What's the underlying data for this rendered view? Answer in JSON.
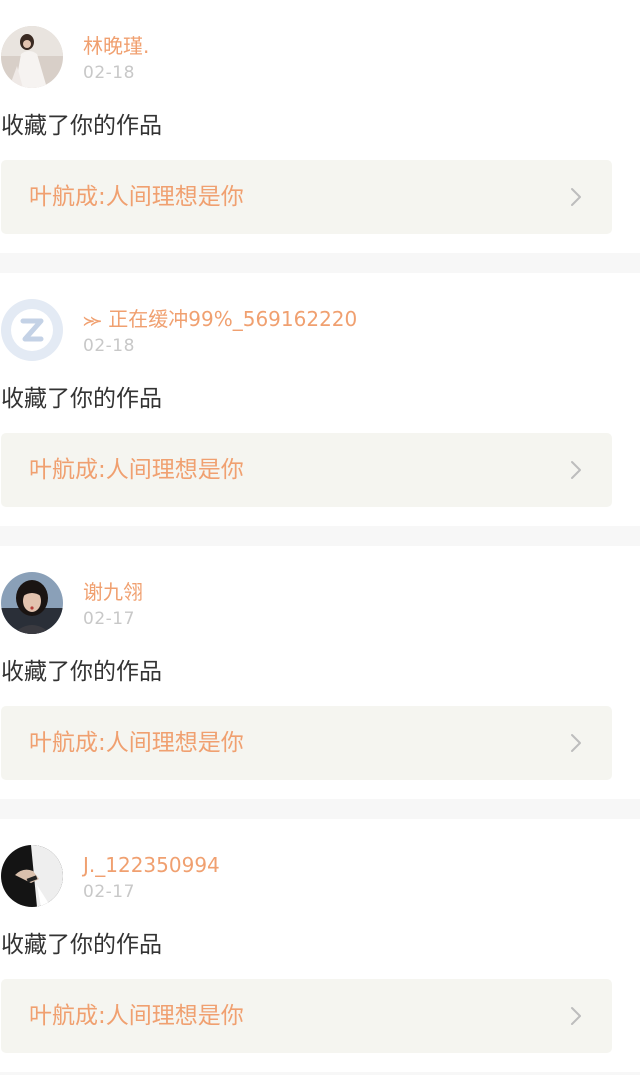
{
  "notifications": [
    {
      "user": "林晚瑾.",
      "date": "02-18",
      "action": "收藏了你的作品",
      "work_title": "叶航成:人间理想是你",
      "avatar_icon": "user-photo-white-dress"
    },
    {
      "user": "⪼ 正在缓冲99%_569162220",
      "date": "02-18",
      "action": "收藏了你的作品",
      "work_title": "叶航成:人间理想是你",
      "avatar_icon": "default-z-logo"
    },
    {
      "user": "谢九翎",
      "date": "02-17",
      "action": "收藏了你的作品",
      "work_title": "叶航成:人间理想是你",
      "avatar_icon": "user-photo-dark-hair"
    },
    {
      "user": "J._122350994",
      "date": "02-17",
      "action": "收藏了你的作品",
      "work_title": "叶航成:人间理想是你",
      "avatar_icon": "user-photo-dark-hand"
    }
  ],
  "colors": {
    "accent": "#f0a070",
    "muted": "#c8c8c8",
    "text": "#333333",
    "link_bg": "#f5f5f0",
    "divider": "#f7f7f7"
  }
}
